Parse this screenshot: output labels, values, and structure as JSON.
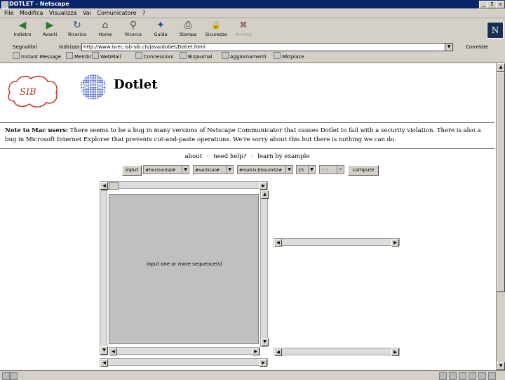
{
  "window": {
    "title": "DOTLET - Netscape",
    "min": "_",
    "max": "5",
    "close": "x"
  },
  "menu": [
    "File",
    "Modifica",
    "Visualizza",
    "Vai",
    "Comunicatore",
    "?"
  ],
  "toolbar": [
    {
      "label": "Indietro",
      "icon": "back-arrow-icon",
      "glyph": "◀",
      "disabled": false
    },
    {
      "label": "Avanti",
      "icon": "forward-arrow-icon",
      "glyph": "▶",
      "disabled": false
    },
    {
      "label": "Ricarica",
      "icon": "reload-icon",
      "glyph": "↻",
      "disabled": false
    },
    {
      "label": "Home",
      "icon": "home-icon",
      "glyph": "⌂",
      "disabled": false
    },
    {
      "label": "Ricerca",
      "icon": "search-icon",
      "glyph": "⚲",
      "disabled": false
    },
    {
      "label": "Guida",
      "icon": "guide-icon",
      "glyph": "✦",
      "disabled": false
    },
    {
      "label": "Stampa",
      "icon": "print-icon",
      "glyph": "⎙",
      "disabled": false
    },
    {
      "label": "Sicurezza",
      "icon": "lock-icon",
      "glyph": "🔒",
      "disabled": false
    },
    {
      "label": "Arresta",
      "icon": "stop-icon",
      "glyph": "✖",
      "disabled": true
    }
  ],
  "brand_logo": "N",
  "location": {
    "bookmarks_label": "Segnalibri",
    "address_label": "Indirizzo:",
    "url": "http://www.isrec.isb-sib.ch/java/dotlet/Dotlet.html",
    "related_label": "Correlate"
  },
  "personal_bar": [
    "Instant Message",
    "Membri",
    "WebMail",
    "Connessioni",
    "BizJournal",
    "Aggiornamenti",
    "Mktplace"
  ],
  "page": {
    "sib_logo_text": "SIB",
    "title": "Dotlet",
    "note_bold": "Note to Mac users:",
    "note_text": " There seems to be a bug in many versions of Netscape Communicator that causes Dotlet to fail with a security violation. There is also a bug in Microsoft Internet Explorer that prevents cut-and-paste operations. We're sorry about this but there is nothing we can do.",
    "links": [
      "about",
      "need help?",
      "learn by example"
    ],
    "separator": "·",
    "controls": {
      "input_button": "input",
      "horizontal": "#horizontal#",
      "vertical": "#vertical#",
      "matrix": "#matrix:blosum62#",
      "window_size": "15",
      "compression": "1:1",
      "compute_button": "compute"
    },
    "panel_message": "input one or more sequence(s)"
  },
  "colors": {
    "titlebar": "#0a246a",
    "chrome": "#d4d0c8",
    "panel": "#c0c0c0"
  }
}
